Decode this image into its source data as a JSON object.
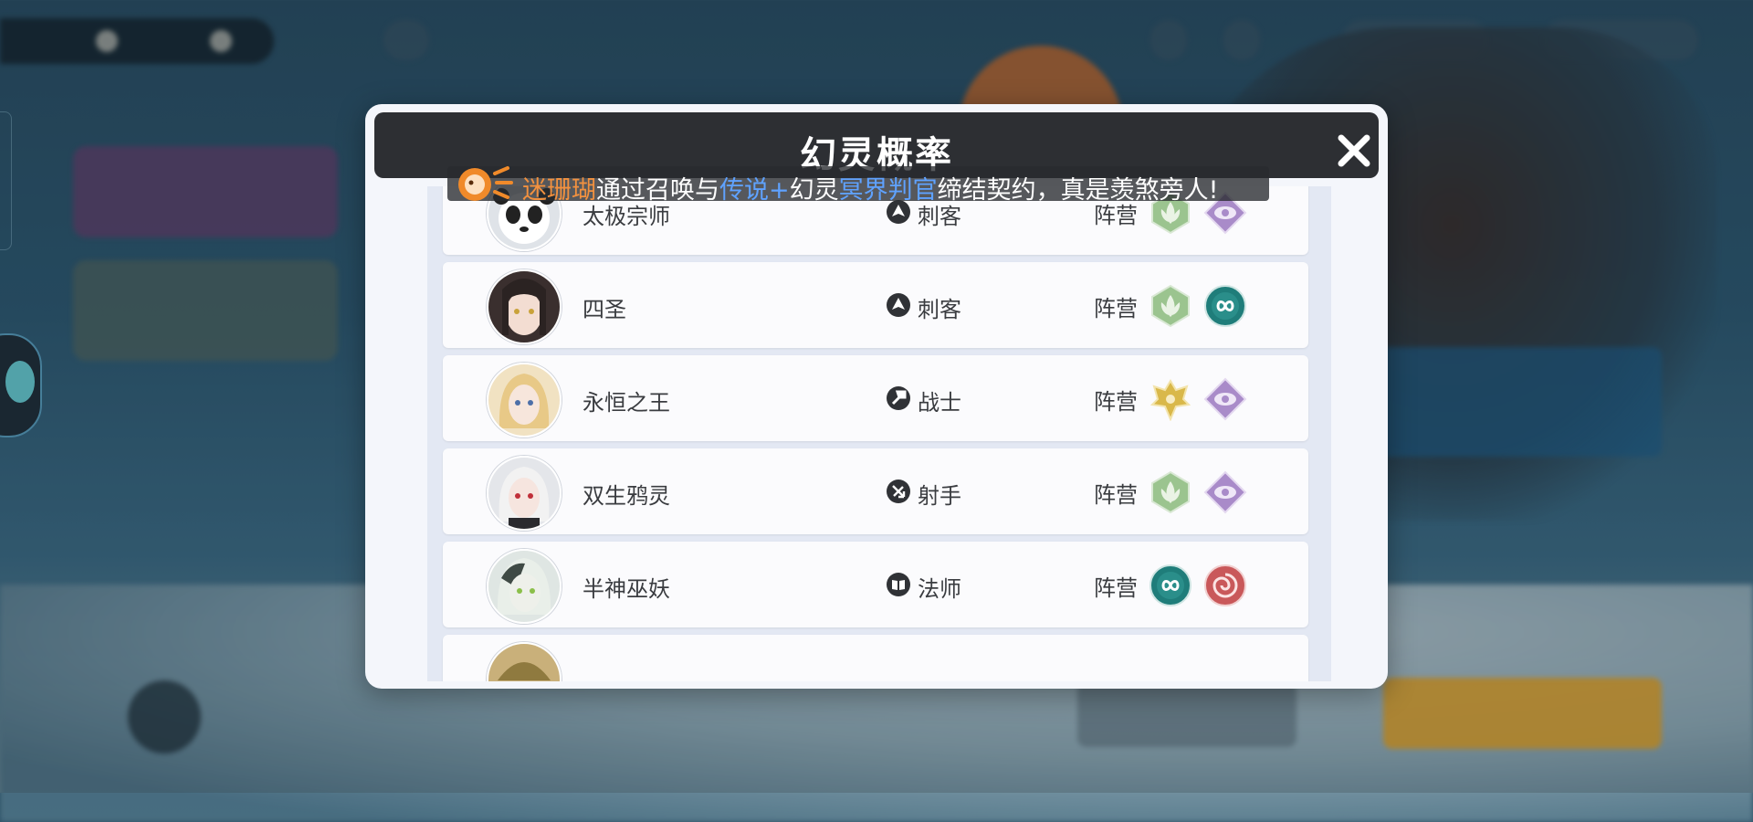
{
  "dialog": {
    "title": "幻灵概率",
    "close_icon": "close-x-icon"
  },
  "ticker": {
    "icon": "speaker-mascot-icon",
    "player": "迷珊瑚",
    "text_1": "通过召唤与",
    "rarity": "传说+",
    "text_2": "幻灵",
    "spirit": "冥界判官",
    "text_3": "缔结契约，真是羡煞旁人!"
  },
  "rows": [
    {
      "name": "太极宗师",
      "role": "刺客",
      "role_icon": "assassin-icon",
      "camp_label": "阵营",
      "camps": [
        "leaf-camp-icon",
        "eye-camp-icon"
      ],
      "avatar": "panda"
    },
    {
      "name": "四圣",
      "role": "刺客",
      "role_icon": "assassin-icon",
      "camp_label": "阵营",
      "camps": [
        "leaf-camp-icon",
        "infinity-camp-icon"
      ],
      "avatar": "dark-hair"
    },
    {
      "name": "永恒之王",
      "role": "战士",
      "role_icon": "warrior-icon",
      "camp_label": "阵营",
      "camps": [
        "crown-wing-camp-icon",
        "eye-camp-icon"
      ],
      "avatar": "blonde"
    },
    {
      "name": "双生鸦灵",
      "role": "射手",
      "role_icon": "marksman-icon",
      "camp_label": "阵营",
      "camps": [
        "leaf-camp-icon",
        "eye-camp-icon"
      ],
      "avatar": "white-hair"
    },
    {
      "name": "半神巫妖",
      "role": "法师",
      "role_icon": "mage-icon",
      "camp_label": "阵营",
      "camps": [
        "infinity-camp-icon",
        "spiral-camp-icon"
      ],
      "avatar": "green-hair"
    }
  ],
  "colors": {
    "header_bg": "#2d2f33",
    "dialog_bg": "#f4f6fb",
    "leaf_camp": "#9bc48f",
    "eye_camp": "#a98bc9",
    "infinity_camp": "#1f7d7a",
    "spiral_camp": "#c9585a",
    "crown_camp": "#d9b84a"
  }
}
